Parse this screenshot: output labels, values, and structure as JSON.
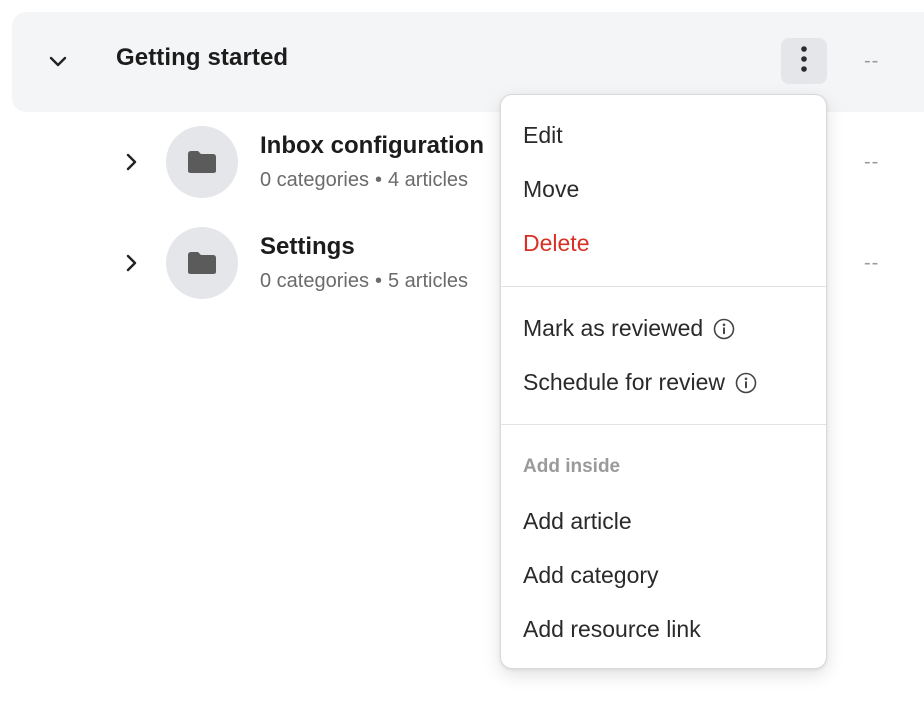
{
  "header": {
    "title": "Getting started",
    "expand_icon": "chevron-down-icon",
    "more_icon": "more-vertical-icon",
    "trailing": "--"
  },
  "children": [
    {
      "title": "Inbox configuration",
      "categories": "0 categories",
      "separator": "•",
      "articles": "4 articles",
      "trailing": "--",
      "icon": "folder-icon"
    },
    {
      "title": "Settings",
      "categories": "0 categories",
      "separator": "•",
      "articles": "5 articles",
      "trailing": "--",
      "icon": "folder-icon"
    }
  ],
  "menu": {
    "edit": "Edit",
    "move": "Move",
    "delete": "Delete",
    "mark_reviewed": "Mark as reviewed",
    "schedule_review": "Schedule for review",
    "section_label": "Add inside",
    "add_article": "Add article",
    "add_category": "Add category",
    "add_resource_link": "Add resource link"
  },
  "colors": {
    "danger": "#d93025",
    "row_bg": "#f4f5f7",
    "icon_bg": "#e4e6ea"
  }
}
